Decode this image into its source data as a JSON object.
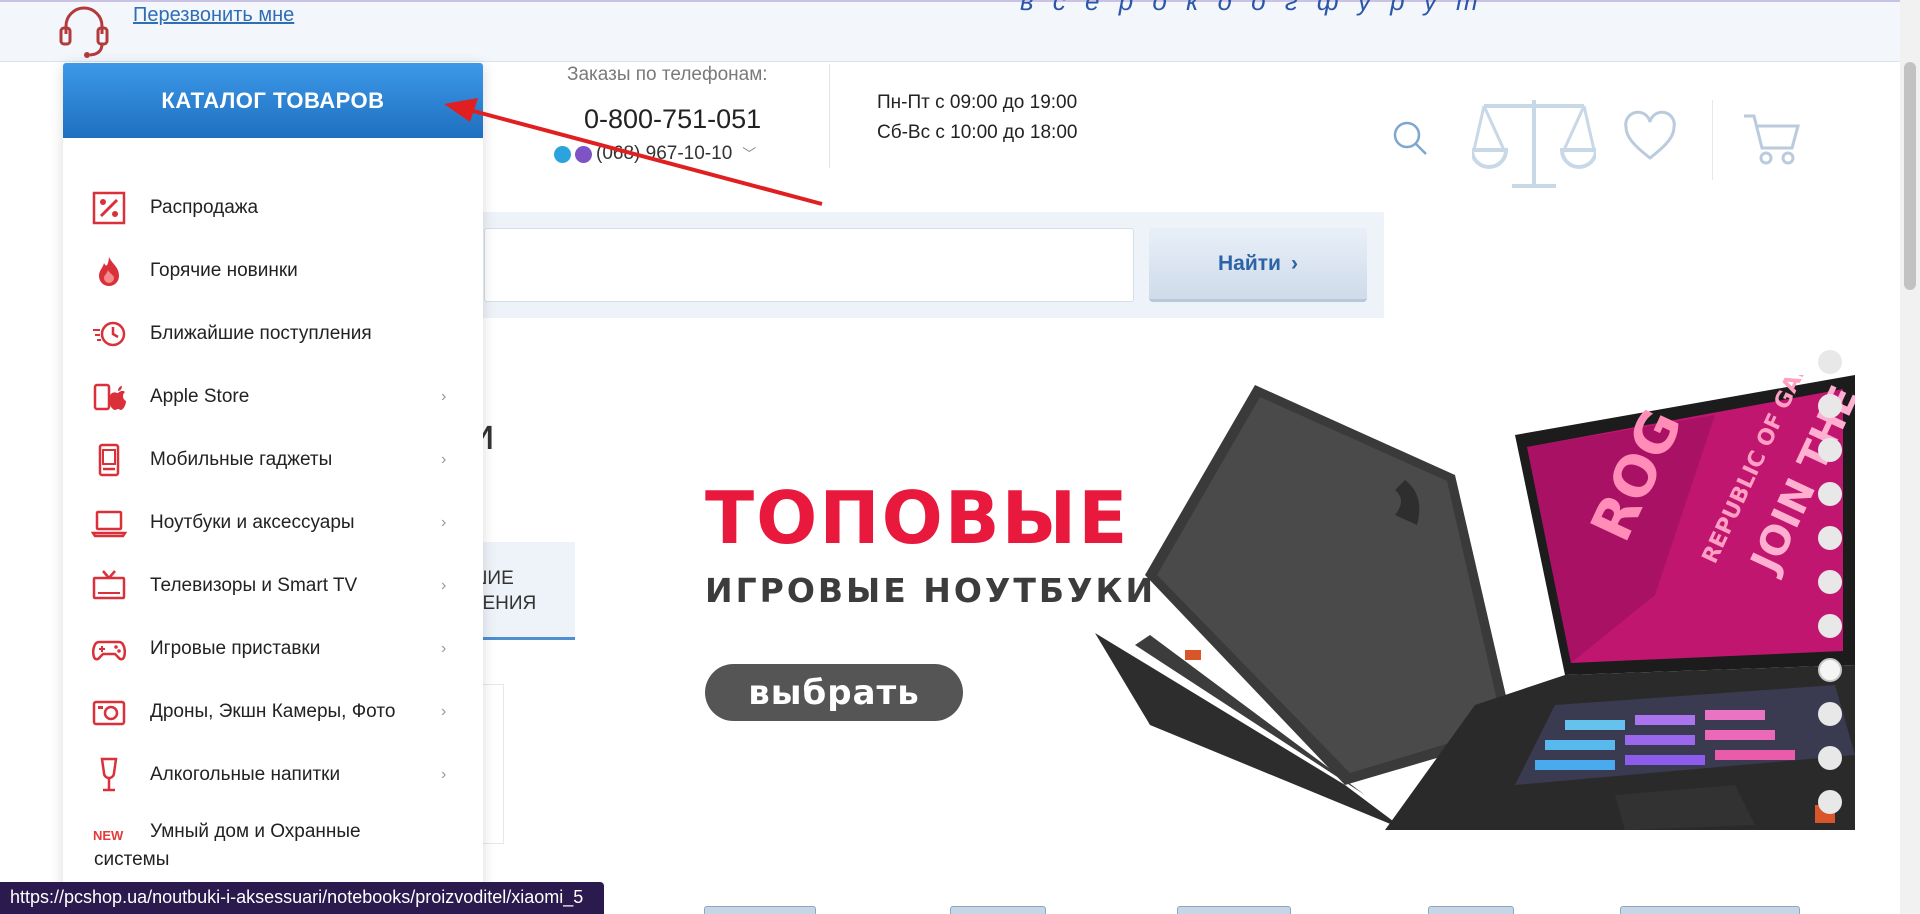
{
  "topbar": {
    "callback_label": "Перезвонить мне",
    "slogan_partial": "в с е р о к д о г ф у р у т"
  },
  "contacts": {
    "orders_label": "Заказы по телефонам:",
    "phone_main": "0-800-751-051",
    "phone_mobile": "(068) 967-10-10",
    "hours_weekdays": "Пн-Пт с 09:00 до 19:00",
    "hours_weekend": "Сб-Вс с 10:00 до 18:00"
  },
  "search": {
    "placeholder": "",
    "button_label": "Найти"
  },
  "catalog": {
    "title": "КАТАЛОГ ТОВАРОВ",
    "items": [
      {
        "label": "Распродажа",
        "icon": "sale-icon",
        "has_children": false
      },
      {
        "label": "Горячие новинки",
        "icon": "fire-icon",
        "has_children": false
      },
      {
        "label": "Ближайшие поступления",
        "icon": "clock-icon",
        "has_children": false
      },
      {
        "label": "Apple Store",
        "icon": "apple-icon",
        "has_children": true
      },
      {
        "label": "Мобильные гаджеты",
        "icon": "phone-icon",
        "has_children": true
      },
      {
        "label": "Ноутбуки и аксессуары",
        "icon": "laptop-icon",
        "has_children": true
      },
      {
        "label": "Телевизоры и Smart TV",
        "icon": "tv-icon",
        "has_children": true
      },
      {
        "label": "Игровые приставки",
        "icon": "gamepad-icon",
        "has_children": true
      },
      {
        "label": "Дроны, Экшн Камеры, Фото",
        "icon": "camera-icon",
        "has_children": true
      },
      {
        "label": "Алкогольные напитки",
        "icon": "wine-glass-icon",
        "has_children": true
      },
      {
        "label": "Умный дом и Охранные системы",
        "label_line1": "Умный дом и Охранные",
        "label_line2": "системы",
        "badge": "NEW",
        "has_children": false
      }
    ]
  },
  "partial": {
    "heading_tail": "и",
    "tab_line1": "ШИЕ",
    "tab_line2": "ЛЕНИЯ"
  },
  "banner": {
    "title": "ТОПОВЫЕ",
    "subtitle": "ИГРОВЫЕ НОУТБУКИ",
    "cta_label": "выбрать",
    "slide_count": 11,
    "active_slide": 8
  },
  "laptop_screen": {
    "text1": "ROG",
    "text2": "REPUBLIC OF GAMERS",
    "text3": "JOIN THE"
  },
  "status_url": "https://pcshop.ua/noutbuki-i-aksessuari/notebooks/proizvoditel/xiaomi_5",
  "colors": {
    "accent_blue": "#1f6fc0",
    "brand_red": "#e33b3b",
    "banner_red": "#e8193c",
    "annotation_arrow": "#e02020"
  }
}
